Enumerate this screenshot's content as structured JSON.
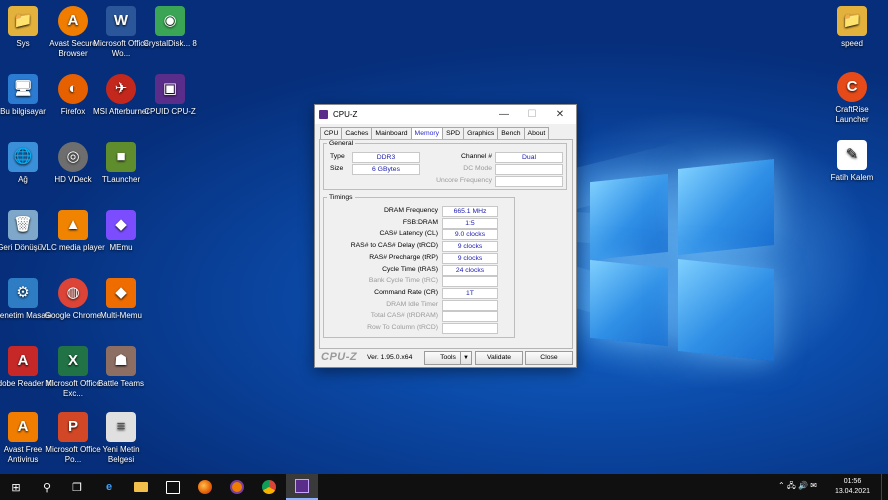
{
  "desktop": {
    "icons": [
      {
        "label": "Sys",
        "glyph": "📁",
        "color": "#e3b23c"
      },
      {
        "label": "Avast Secure Browser",
        "glyph": "A",
        "color": "#f07d00"
      },
      {
        "label": "Microsoft Office Wo...",
        "glyph": "W",
        "color": "#2b579a"
      },
      {
        "label": "CrystalDisk... 8",
        "glyph": "◉",
        "color": "#3aa655"
      },
      {
        "label": "Bu bilgisayar",
        "glyph": "🖥",
        "color": "#2a7bd1"
      },
      {
        "label": "Firefox",
        "glyph": "◐",
        "color": "#e66000"
      },
      {
        "label": "MSI Afterburner",
        "glyph": "✈",
        "color": "#c4281c"
      },
      {
        "label": "CPUID CPU-Z",
        "glyph": "▣",
        "color": "#5a2d8a"
      },
      {
        "label": "Ağ",
        "glyph": "🌐",
        "color": "#3a8fd8"
      },
      {
        "label": "HD VDeck",
        "glyph": "◎",
        "color": "#6e6e6e"
      },
      {
        "label": "TLauncher",
        "glyph": "■",
        "color": "#5f8c2c"
      },
      {
        "label": "Geri Dönüşü...",
        "glyph": "🗑",
        "color": "#7ea7c9"
      },
      {
        "label": "VLC media player",
        "glyph": "▲",
        "color": "#f08300"
      },
      {
        "label": "MEmu",
        "glyph": "◆",
        "color": "#7c4dff"
      },
      {
        "label": "Denetim Masası",
        "glyph": "⚙",
        "color": "#2d7cc4"
      },
      {
        "label": "Google Chrome",
        "glyph": "◍",
        "color": "#db4437"
      },
      {
        "label": "Multi-Memu",
        "glyph": "◆",
        "color": "#ef6c00"
      },
      {
        "label": "Adobe Reader XI",
        "glyph": "A",
        "color": "#c62828"
      },
      {
        "label": "Microsoft Office Exc...",
        "glyph": "X",
        "color": "#217346"
      },
      {
        "label": "Battle Teams",
        "glyph": "☗",
        "color": "#8d6e63"
      },
      {
        "label": "Avast Free Antivirus",
        "glyph": "A",
        "color": "#f07d00"
      },
      {
        "label": "Microsoft Office Po...",
        "glyph": "P",
        "color": "#d24726"
      },
      {
        "label": "Yeni Metin Belgesi",
        "glyph": "≡",
        "color": "#e0e0e0"
      },
      {
        "label": "speed",
        "glyph": "📁",
        "color": "#e3b23c"
      },
      {
        "label": "CraftRise Launcher",
        "glyph": "C",
        "color": "#e64a19"
      },
      {
        "label": "Fatih Kalem",
        "glyph": "✎",
        "color": "#ffffff"
      }
    ]
  },
  "window": {
    "title": "CPU-Z",
    "minimize": "—",
    "maximize": "☐",
    "close": "✕",
    "tabs": [
      "CPU",
      "Caches",
      "Mainboard",
      "Memory",
      "SPD",
      "Graphics",
      "Bench",
      "About"
    ],
    "active_tab": "Memory",
    "general": {
      "legend": "General",
      "type_label": "Type",
      "type_value": "DDR3",
      "size_label": "Size",
      "size_value": "6 GBytes",
      "channel_label": "Channel #",
      "channel_value": "Dual",
      "dc_mode_label": "DC Mode",
      "dc_mode_value": "",
      "uncore_label": "Uncore Frequency",
      "uncore_value": ""
    },
    "timings": {
      "legend": "Timings",
      "rows": [
        {
          "label": "DRAM Frequency",
          "value": "665.1 MHz",
          "dim": false
        },
        {
          "label": "FSB:DRAM",
          "value": "1:5",
          "dim": false
        },
        {
          "label": "CAS# Latency (CL)",
          "value": "9.0 clocks",
          "dim": false
        },
        {
          "label": "RAS# to CAS# Delay (tRCD)",
          "value": "9 clocks",
          "dim": false
        },
        {
          "label": "RAS# Precharge (tRP)",
          "value": "9 clocks",
          "dim": false
        },
        {
          "label": "Cycle Time (tRAS)",
          "value": "24 clocks",
          "dim": false
        },
        {
          "label": "Bank Cycle Time (tRC)",
          "value": "",
          "dim": true
        },
        {
          "label": "Command Rate (CR)",
          "value": "1T",
          "dim": false
        },
        {
          "label": "DRAM Idle Timer",
          "value": "",
          "dim": true
        },
        {
          "label": "Total CAS# (tRDRAM)",
          "value": "",
          "dim": true
        },
        {
          "label": "Row To Column (tRCD)",
          "value": "",
          "dim": true
        }
      ]
    },
    "brand": "CPU-Z",
    "version": "Ver. 1.95.0.x64",
    "tools_label": "Tools",
    "validate_label": "Validate",
    "close_label": "Close"
  },
  "taskbar": {
    "start_icon": "⊞",
    "search_icon": "⚲",
    "taskview_icon": "❐",
    "tray_icons": "⌃ 🖧 🔊 ✉",
    "time": "01:56",
    "date": "13.04.2021"
  }
}
